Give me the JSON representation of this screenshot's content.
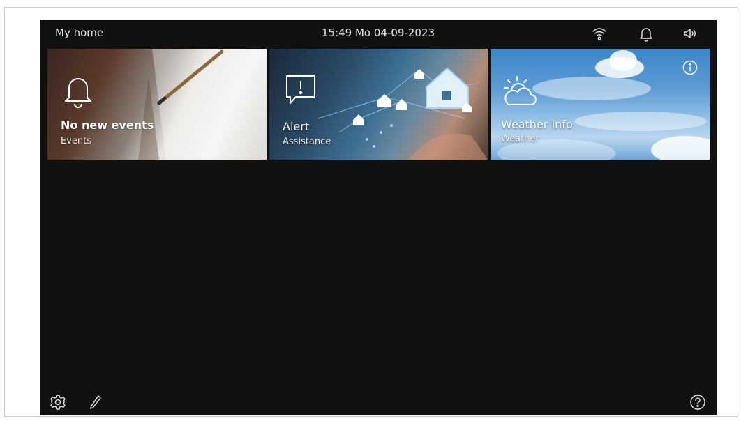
{
  "statusbar": {
    "title": "My home",
    "datetime": "15:49  Mo 04-09-2023",
    "icons": [
      "wifi-icon",
      "bell-icon",
      "speaker-icon"
    ]
  },
  "tiles": [
    {
      "title": "No new events",
      "subtitle": "Events",
      "icon": "bell-icon"
    },
    {
      "title": "Alert",
      "subtitle": "Assistance",
      "icon": "alert-message-icon"
    },
    {
      "title": "Weather Info",
      "subtitle": "Weather",
      "icon": "sun-cloud-icon",
      "extra_icon": "info-icon"
    }
  ],
  "bottombar": {
    "icons": [
      "gear-icon",
      "pencil-icon",
      "help-icon"
    ]
  },
  "colors": {
    "screen_background": "#111111",
    "text": "#ffffff"
  }
}
